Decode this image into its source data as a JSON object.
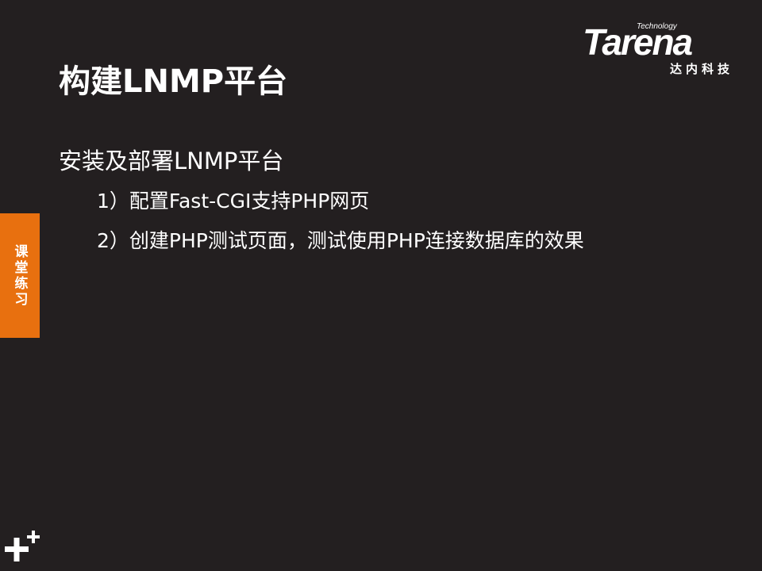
{
  "slide": {
    "title": "构建LNMP平台",
    "side_tab": "课堂练习",
    "heading": "安装及部署LNMP平台",
    "items": [
      "1）配置Fast-CGI支持PHP网页",
      "2）创建PHP测试页面，测试使用PHP连接数据库的效果"
    ]
  },
  "logo": {
    "technology": "Technology",
    "word": "Tarena",
    "cn": "达内科技"
  },
  "icons": {
    "bottom_left": "plus-mark-icon"
  },
  "colors": {
    "background": "#231f20",
    "accent": "#e8700f",
    "text": "#ffffff"
  }
}
